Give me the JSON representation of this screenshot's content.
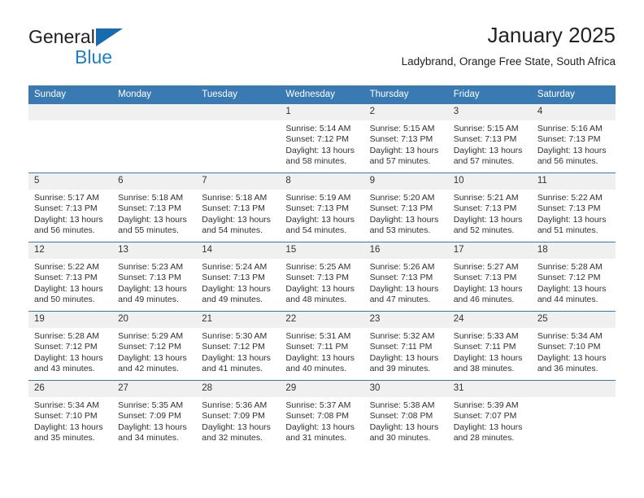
{
  "brand": {
    "name_part1": "General",
    "name_part2": "Blue",
    "triangle_color": "#156cb0",
    "blue_color": "#1f7fc4"
  },
  "header": {
    "title": "January 2025",
    "subtitle": "Ladybrand, Orange Free State, South Africa"
  },
  "theme": {
    "header_blue": "#3a7ab3",
    "daynum_band": "#f0f0f0",
    "text": "#303030"
  },
  "calendar": {
    "weekday_headers": [
      "Sunday",
      "Monday",
      "Tuesday",
      "Wednesday",
      "Thursday",
      "Friday",
      "Saturday"
    ],
    "weeks": [
      [
        {
          "day": "",
          "lines": []
        },
        {
          "day": "",
          "lines": []
        },
        {
          "day": "",
          "lines": []
        },
        {
          "day": "1",
          "lines": [
            "Sunrise: 5:14 AM",
            "Sunset: 7:12 PM",
            "Daylight: 13 hours and 58 minutes."
          ]
        },
        {
          "day": "2",
          "lines": [
            "Sunrise: 5:15 AM",
            "Sunset: 7:13 PM",
            "Daylight: 13 hours and 57 minutes."
          ]
        },
        {
          "day": "3",
          "lines": [
            "Sunrise: 5:15 AM",
            "Sunset: 7:13 PM",
            "Daylight: 13 hours and 57 minutes."
          ]
        },
        {
          "day": "4",
          "lines": [
            "Sunrise: 5:16 AM",
            "Sunset: 7:13 PM",
            "Daylight: 13 hours and 56 minutes."
          ]
        }
      ],
      [
        {
          "day": "5",
          "lines": [
            "Sunrise: 5:17 AM",
            "Sunset: 7:13 PM",
            "Daylight: 13 hours and 56 minutes."
          ]
        },
        {
          "day": "6",
          "lines": [
            "Sunrise: 5:18 AM",
            "Sunset: 7:13 PM",
            "Daylight: 13 hours and 55 minutes."
          ]
        },
        {
          "day": "7",
          "lines": [
            "Sunrise: 5:18 AM",
            "Sunset: 7:13 PM",
            "Daylight: 13 hours and 54 minutes."
          ]
        },
        {
          "day": "8",
          "lines": [
            "Sunrise: 5:19 AM",
            "Sunset: 7:13 PM",
            "Daylight: 13 hours and 54 minutes."
          ]
        },
        {
          "day": "9",
          "lines": [
            "Sunrise: 5:20 AM",
            "Sunset: 7:13 PM",
            "Daylight: 13 hours and 53 minutes."
          ]
        },
        {
          "day": "10",
          "lines": [
            "Sunrise: 5:21 AM",
            "Sunset: 7:13 PM",
            "Daylight: 13 hours and 52 minutes."
          ]
        },
        {
          "day": "11",
          "lines": [
            "Sunrise: 5:22 AM",
            "Sunset: 7:13 PM",
            "Daylight: 13 hours and 51 minutes."
          ]
        }
      ],
      [
        {
          "day": "12",
          "lines": [
            "Sunrise: 5:22 AM",
            "Sunset: 7:13 PM",
            "Daylight: 13 hours and 50 minutes."
          ]
        },
        {
          "day": "13",
          "lines": [
            "Sunrise: 5:23 AM",
            "Sunset: 7:13 PM",
            "Daylight: 13 hours and 49 minutes."
          ]
        },
        {
          "day": "14",
          "lines": [
            "Sunrise: 5:24 AM",
            "Sunset: 7:13 PM",
            "Daylight: 13 hours and 49 minutes."
          ]
        },
        {
          "day": "15",
          "lines": [
            "Sunrise: 5:25 AM",
            "Sunset: 7:13 PM",
            "Daylight: 13 hours and 48 minutes."
          ]
        },
        {
          "day": "16",
          "lines": [
            "Sunrise: 5:26 AM",
            "Sunset: 7:13 PM",
            "Daylight: 13 hours and 47 minutes."
          ]
        },
        {
          "day": "17",
          "lines": [
            "Sunrise: 5:27 AM",
            "Sunset: 7:13 PM",
            "Daylight: 13 hours and 46 minutes."
          ]
        },
        {
          "day": "18",
          "lines": [
            "Sunrise: 5:28 AM",
            "Sunset: 7:12 PM",
            "Daylight: 13 hours and 44 minutes."
          ]
        }
      ],
      [
        {
          "day": "19",
          "lines": [
            "Sunrise: 5:28 AM",
            "Sunset: 7:12 PM",
            "Daylight: 13 hours and 43 minutes."
          ]
        },
        {
          "day": "20",
          "lines": [
            "Sunrise: 5:29 AM",
            "Sunset: 7:12 PM",
            "Daylight: 13 hours and 42 minutes."
          ]
        },
        {
          "day": "21",
          "lines": [
            "Sunrise: 5:30 AM",
            "Sunset: 7:12 PM",
            "Daylight: 13 hours and 41 minutes."
          ]
        },
        {
          "day": "22",
          "lines": [
            "Sunrise: 5:31 AM",
            "Sunset: 7:11 PM",
            "Daylight: 13 hours and 40 minutes."
          ]
        },
        {
          "day": "23",
          "lines": [
            "Sunrise: 5:32 AM",
            "Sunset: 7:11 PM",
            "Daylight: 13 hours and 39 minutes."
          ]
        },
        {
          "day": "24",
          "lines": [
            "Sunrise: 5:33 AM",
            "Sunset: 7:11 PM",
            "Daylight: 13 hours and 38 minutes."
          ]
        },
        {
          "day": "25",
          "lines": [
            "Sunrise: 5:34 AM",
            "Sunset: 7:10 PM",
            "Daylight: 13 hours and 36 minutes."
          ]
        }
      ],
      [
        {
          "day": "26",
          "lines": [
            "Sunrise: 5:34 AM",
            "Sunset: 7:10 PM",
            "Daylight: 13 hours and 35 minutes."
          ]
        },
        {
          "day": "27",
          "lines": [
            "Sunrise: 5:35 AM",
            "Sunset: 7:09 PM",
            "Daylight: 13 hours and 34 minutes."
          ]
        },
        {
          "day": "28",
          "lines": [
            "Sunrise: 5:36 AM",
            "Sunset: 7:09 PM",
            "Daylight: 13 hours and 32 minutes."
          ]
        },
        {
          "day": "29",
          "lines": [
            "Sunrise: 5:37 AM",
            "Sunset: 7:08 PM",
            "Daylight: 13 hours and 31 minutes."
          ]
        },
        {
          "day": "30",
          "lines": [
            "Sunrise: 5:38 AM",
            "Sunset: 7:08 PM",
            "Daylight: 13 hours and 30 minutes."
          ]
        },
        {
          "day": "31",
          "lines": [
            "Sunrise: 5:39 AM",
            "Sunset: 7:07 PM",
            "Daylight: 13 hours and 28 minutes."
          ]
        },
        {
          "day": "",
          "lines": []
        }
      ]
    ]
  }
}
